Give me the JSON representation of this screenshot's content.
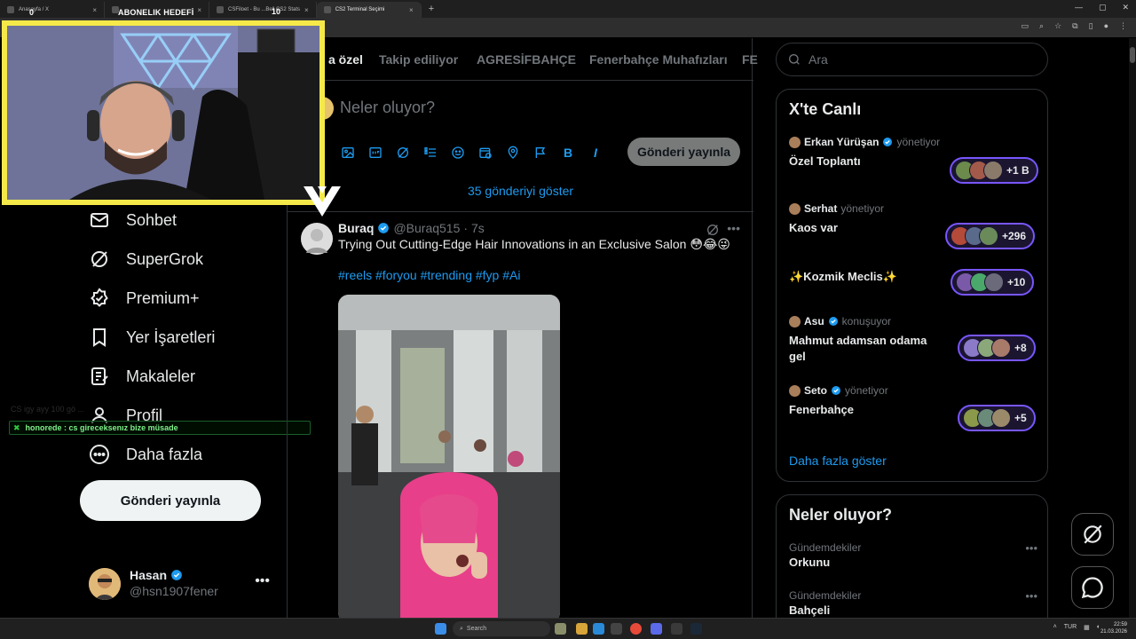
{
  "browser": {
    "tabs": [
      {
        "label": "Anasayfa / X",
        "active": false
      },
      {
        "label": "",
        "active": false
      },
      {
        "label": "CSFiloet - Bu ...Bell CS2 Stats",
        "active": false
      },
      {
        "label": "CS2 Terminal Seçimi",
        "active": true
      }
    ],
    "new_tab": "+"
  },
  "overlay": {
    "subscriber_goal": "ABONELIK HEDEFİ",
    "goal_start": "0",
    "goal_end": "10",
    "chat_user": "honorede",
    "chat_message": "honorede : cs gireceksenız bize müsade",
    "chat_faint": "CS igy ayy 100 gö ..."
  },
  "nav": {
    "items": [
      {
        "label": "Sohbet",
        "icon": "mail-icon"
      },
      {
        "label": "SuperGrok",
        "icon": "grok-icon"
      },
      {
        "label": "Premium+",
        "icon": "premium-icon"
      },
      {
        "label": "Yer İşaretleri",
        "icon": "bookmark-icon"
      },
      {
        "label": "Makaleler",
        "icon": "articles-icon"
      },
      {
        "label": "Profil",
        "icon": "profile-icon"
      },
      {
        "label": "Daha fazla",
        "icon": "more-circle-icon"
      }
    ],
    "post_button": "Gönderi yayınla",
    "user_name": "Hasan",
    "user_handle": "@hsn1907fener"
  },
  "feed": {
    "tabs": [
      "a özel",
      "Takip ediliyor",
      "AGRESİFBAHÇE",
      "Fenerbahçe Muhafızları",
      "FE"
    ],
    "composer_placeholder": "Neler oluyor?",
    "composer_button": "Gönderi yayınla",
    "composer_tools": [
      "image-icon",
      "gif-icon",
      "grok-icon",
      "poll-icon",
      "emoji-icon",
      "schedule-icon",
      "location-icon",
      "flag-icon",
      "bold-icon",
      "italic-icon"
    ],
    "show_new": "35 gönderiyi göster",
    "tweet": {
      "name": "Buraq",
      "handle": "@Buraq515",
      "time": "· 7s",
      "text": "Trying Out Cutting-Edge Hair Innovations in an Exclusive Salon 😳😂😜",
      "hashtags": "#reels #foryou #trending #fyp #Ai"
    }
  },
  "right": {
    "search_placeholder": "Ara",
    "live_title": "X'te Canlı",
    "live": [
      {
        "host": "Erkan Yürüşan",
        "status": "yönetiyor",
        "title": "Özel Toplantı",
        "count": "+1 B",
        "verified": true
      },
      {
        "host": "Serhat",
        "status": "yönetiyor",
        "title": "Kaos var",
        "count": "+296",
        "verified": false
      },
      {
        "host": "",
        "status": "",
        "title": "✨Kozmik Meclis✨",
        "count": "+10",
        "verified": false
      },
      {
        "host": "Asu",
        "status": "konuşuyor",
        "title": "Mahmut adamsan odama gel",
        "count": "+8",
        "verified": true
      },
      {
        "host": "Seto",
        "status": "yönetiyor",
        "title": "Fenerbahçe",
        "count": "+5",
        "verified": true
      }
    ],
    "show_more": "Daha fazla göster",
    "trends_title": "Neler oluyor?",
    "trends": [
      {
        "category": "Gündemdekiler",
        "name": "Orkunu"
      },
      {
        "category": "Gündemdekiler",
        "name": "Bahçeli"
      }
    ]
  },
  "taskbar": {
    "search": "Search",
    "lang": "TUR",
    "time": "22:59",
    "date": "21.03.2026"
  },
  "colors": {
    "accent": "#1d9bf0",
    "spaces": "#7856ff",
    "cam_border": "#f5e94a"
  }
}
